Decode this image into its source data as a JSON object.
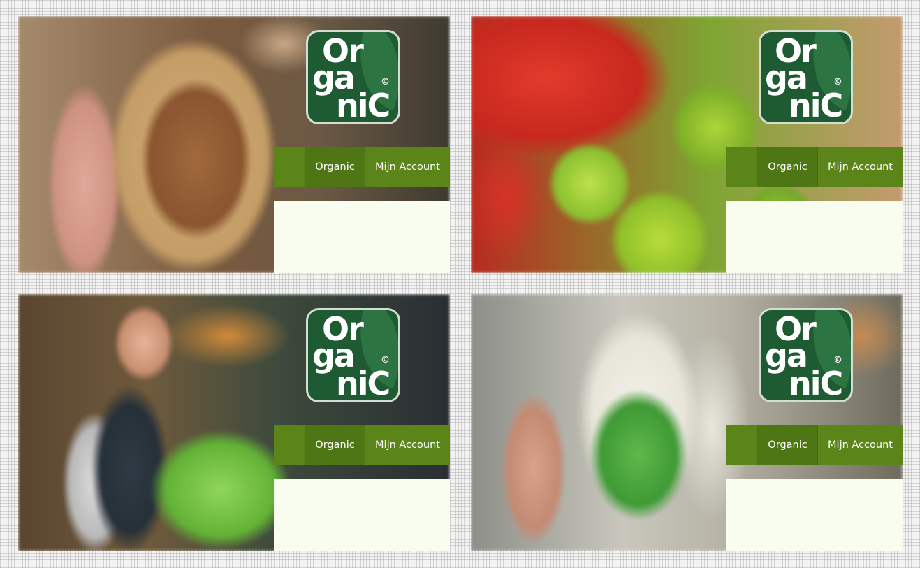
{
  "panels": [
    {
      "scene": "bread-in-hand",
      "logo": {
        "line1": "Or",
        "line2": "ga",
        "line3": "niC",
        "mark": "©"
      },
      "nav": {
        "organic": "Organic",
        "account": "Mijn Account"
      }
    },
    {
      "scene": "tomatoes-and-romanesco",
      "logo": {
        "line1": "Or",
        "line2": "ga",
        "line3": "niC",
        "mark": "©"
      },
      "nav": {
        "organic": "Organic",
        "account": "Mijn Account"
      }
    },
    {
      "scene": "man-holding-lettuce",
      "logo": {
        "line1": "Or",
        "line2": "ga",
        "line3": "niC",
        "mark": "©"
      },
      "nav": {
        "organic": "Organic",
        "account": "Mijn Account"
      }
    },
    {
      "scene": "milk-bottles-in-hand",
      "logo": {
        "line1": "Or",
        "line2": "ga",
        "line3": "niC",
        "mark": "©"
      },
      "nav": {
        "organic": "Organic",
        "account": "Mijn Account"
      }
    }
  ],
  "colors": {
    "logo_bg": "#1e5b33",
    "nav_bg": "#5b8519",
    "nav_active": "#4f7615",
    "content_bg": "#f8fdf0"
  }
}
